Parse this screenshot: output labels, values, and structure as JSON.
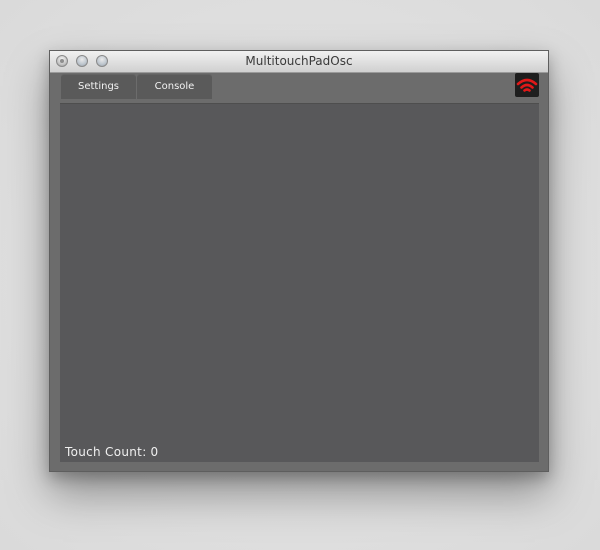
{
  "window": {
    "title": "MultitouchPadOsc"
  },
  "tabs": [
    {
      "label": "Settings"
    },
    {
      "label": "Console"
    }
  ],
  "status": {
    "icon": "wifi-signal-icon",
    "color": "#e01818"
  },
  "pad": {
    "touch_count_label": "Touch Count:",
    "touch_count_value": "0"
  },
  "colors": {
    "window_bg": "#6c6c6c",
    "pad_bg": "#58585a",
    "tab_bg": "#5a5a5a"
  }
}
